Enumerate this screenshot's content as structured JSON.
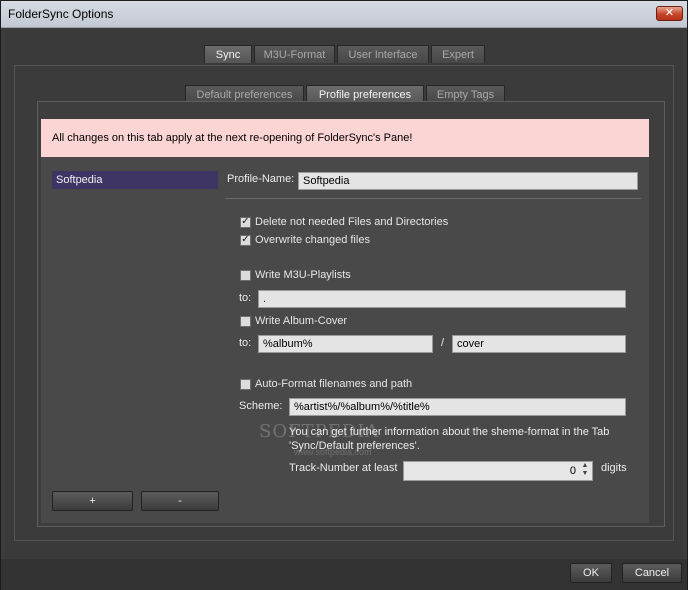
{
  "window": {
    "title": "FolderSync Options",
    "close_glyph": "✕"
  },
  "main_tabs": [
    "Sync",
    "M3U-Format",
    "User Interface",
    "Expert"
  ],
  "sub_tabs": [
    "Default preferences",
    "Profile preferences",
    "Empty Tags"
  ],
  "banner": "All changes on this tab apply at the next re-opening of FolderSync's Pane!",
  "profiles": [
    "Softpedia"
  ],
  "profile": {
    "name_label": "Profile-Name:",
    "name_value": "Softpedia",
    "delete_not_needed": {
      "label": "Delete not needed Files and Directories",
      "checked": true
    },
    "overwrite_changed": {
      "label": "Overwrite changed files",
      "checked": true
    },
    "write_m3u": {
      "label": "Write M3U-Playlists",
      "checked": false
    },
    "m3u_to_label": "to:",
    "m3u_to_value": ".",
    "write_cover": {
      "label": "Write Album-Cover",
      "checked": false
    },
    "cover_to_label": "to:",
    "cover_dir_value": "%album%",
    "cover_sep": "/",
    "cover_file_value": "cover",
    "auto_format": {
      "label": "Auto-Format filenames and path",
      "checked": false
    },
    "scheme_label": "Scheme:",
    "scheme_value": "%artist%/%album%/%title%",
    "info_line1": "You can get further information about the sheme-format in the Tab",
    "info_line2": "'Sync/Default preferences'.",
    "track_label": "Track-Number at least",
    "track_value": "0",
    "track_unit": "digits"
  },
  "profile_buttons": {
    "add": "+",
    "remove": "-"
  },
  "dialog_buttons": {
    "ok": "OK",
    "cancel": "Cancel"
  },
  "watermark": {
    "text": "SOFTPEDIA",
    "sub": "www.softpedia.com"
  },
  "colors": {
    "banner_bg": "#fbd4d4",
    "selected_profile_bg": "#3e3564",
    "close_button": "#c6452a"
  }
}
